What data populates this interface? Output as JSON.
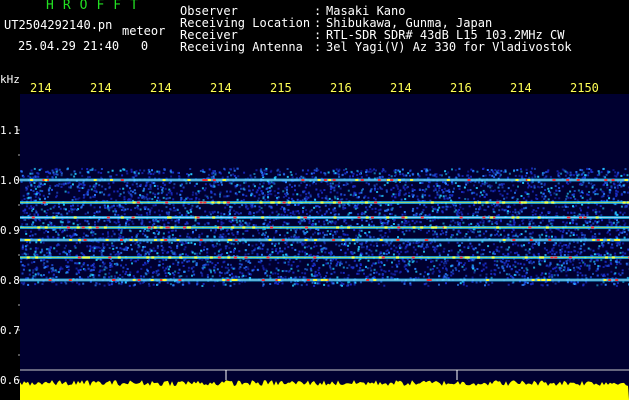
{
  "header": {
    "app_title": "HROFFT",
    "file_name": "UT2504292140.pn",
    "mode": "meteor",
    "datetime": "25.04.29 21:40   0",
    "info": [
      {
        "label": "Observer",
        "value": "Masaki Kano"
      },
      {
        "label": "Receiving Location",
        "value": "Shibukawa, Gunma, Japan"
      },
      {
        "label": "Receiver",
        "value": "RTL-SDR SDR# 43dB L15 103.2MHz CW"
      },
      {
        "label": "Receiving Antenna",
        "value": "3el Yagi(V) Az 330 for Vladivostok"
      }
    ]
  },
  "chart_data": {
    "type": "heatmap",
    "ylabel": "kHz",
    "y_ticks": [
      "1.1",
      "1.0",
      "0.9",
      "0.8",
      "0.7",
      "0.6"
    ],
    "y_range": [
      0.6,
      1.1
    ],
    "x_ticks": [
      "214",
      "214",
      "214",
      "214",
      "215",
      "216",
      "214",
      "216",
      "214",
      "2150"
    ],
    "signal_band_khz": [
      0.79,
      1.025
    ],
    "strong_lines_khz": [
      1.0,
      0.955,
      0.925,
      0.905,
      0.88,
      0.845,
      0.8
    ],
    "colors": {
      "background": "#000030",
      "low": "#1a2cc8",
      "mid": "#22c8ff",
      "high": "#ffff30",
      "peak": "#ff3030",
      "amplitude": "#ffff00"
    }
  }
}
